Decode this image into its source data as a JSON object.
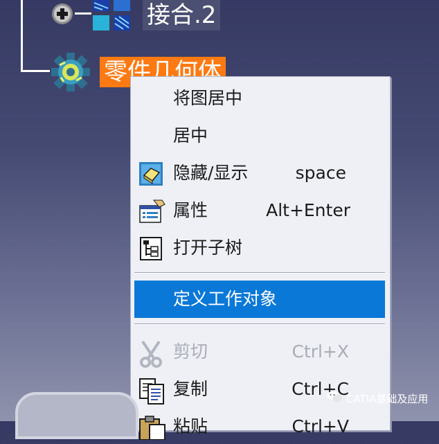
{
  "tree": {
    "assembly_node_label": "接合.2",
    "part_node_label": "零件几何体"
  },
  "context_menu": {
    "items": [
      {
        "label": "将图居中",
        "shortcut": "",
        "icon": "",
        "state": "normal"
      },
      {
        "label": "居中",
        "shortcut": "",
        "icon": "",
        "state": "normal"
      },
      {
        "label": "隐藏/显示",
        "shortcut": "space",
        "icon": "hide-show-icon",
        "state": "normal"
      },
      {
        "label": "属性",
        "shortcut": "Alt+Enter",
        "icon": "properties-icon",
        "state": "normal"
      },
      {
        "label": "打开子树",
        "shortcut": "",
        "icon": "open-subtree-icon",
        "state": "normal"
      },
      {
        "label": "定义工作对象",
        "shortcut": "",
        "icon": "",
        "state": "highlighted"
      },
      {
        "label": "剪切",
        "shortcut": "Ctrl+X",
        "icon": "scissors-icon",
        "state": "disabled"
      },
      {
        "label": "复制",
        "shortcut": "Ctrl+C",
        "icon": "copy-icon",
        "state": "normal"
      },
      {
        "label": "粘贴",
        "shortcut": "Ctrl+V",
        "icon": "paste-icon",
        "state": "normal"
      }
    ]
  },
  "watermark": {
    "text": "CATIA基础及应用"
  },
  "colors": {
    "highlight": "#0a78d7",
    "part_label_bg": "#ff7a12",
    "background_top": "#363a63"
  }
}
